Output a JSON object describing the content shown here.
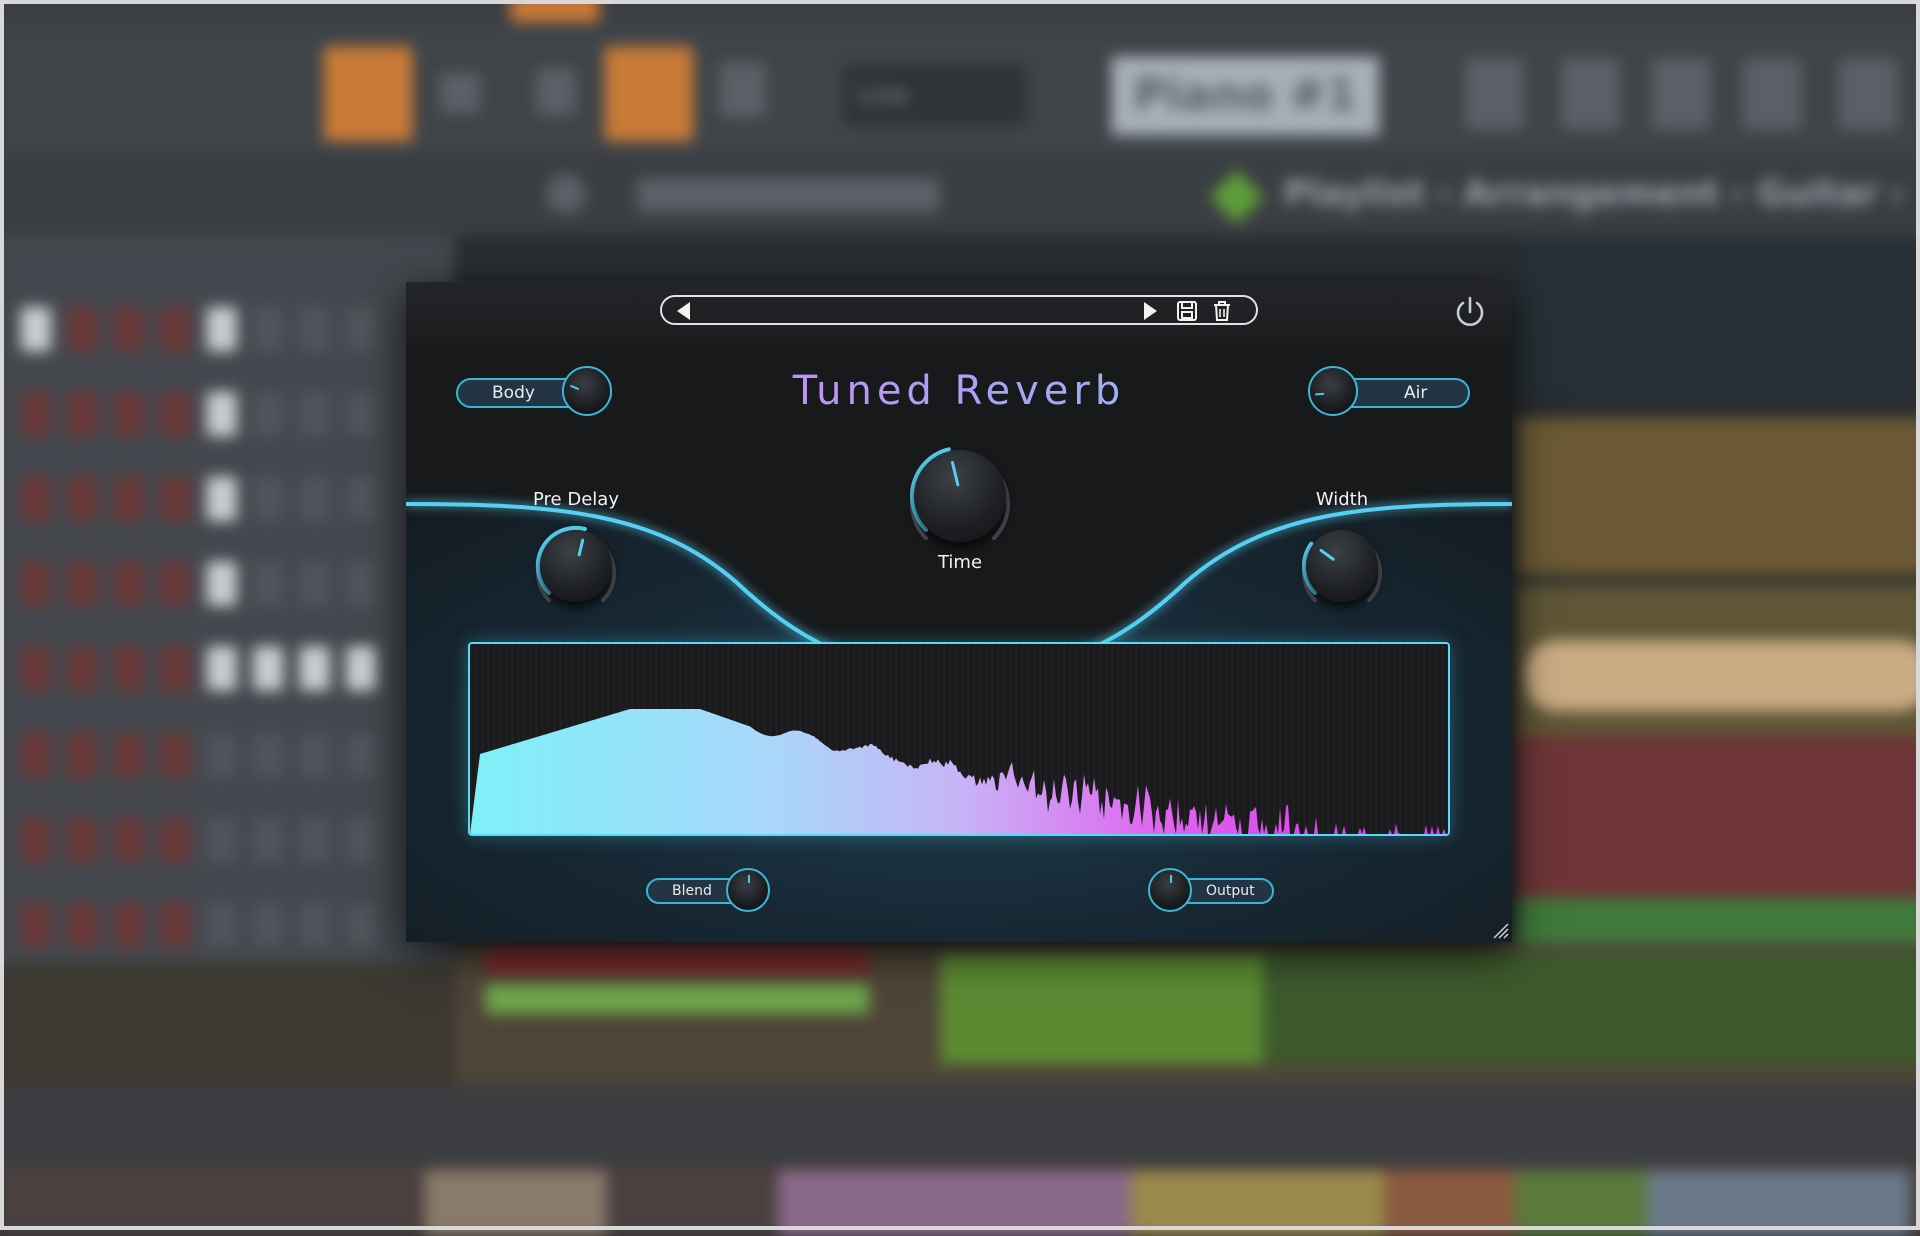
{
  "background": {
    "playlist_breadcrumb": "Playlist - Arrangement › Guitar ›",
    "pattern_name": "Piano #1",
    "snap_mode": "Line"
  },
  "plugin": {
    "title": "Tuned Reverb",
    "preset": {
      "name": "",
      "prev_icon": "triangle-left-icon",
      "next_icon": "triangle-right-icon",
      "save_icon": "floppy-disk-icon",
      "delete_icon": "trash-icon"
    },
    "power_icon": "power-icon",
    "controls": {
      "body": {
        "label": "Body",
        "value": 0.25
      },
      "air": {
        "label": "Air",
        "value": 0.15
      },
      "pre_delay": {
        "label": "Pre Delay",
        "value": 0.55
      },
      "time": {
        "label": "Time",
        "value": 0.45
      },
      "width": {
        "label": "Width",
        "value": 0.3
      },
      "blend": {
        "label": "Blend",
        "value": 0.5
      },
      "output": {
        "label": "Output",
        "value": 0.5
      }
    },
    "colors": {
      "accent": "#3ab8da",
      "title_gradient_start": "#e07cf0",
      "title_gradient_end": "#6fd9ee",
      "spectrum_low": "#7ef0f8",
      "spectrum_mid": "#c8b4f6",
      "spectrum_high": "#e040ee"
    }
  }
}
